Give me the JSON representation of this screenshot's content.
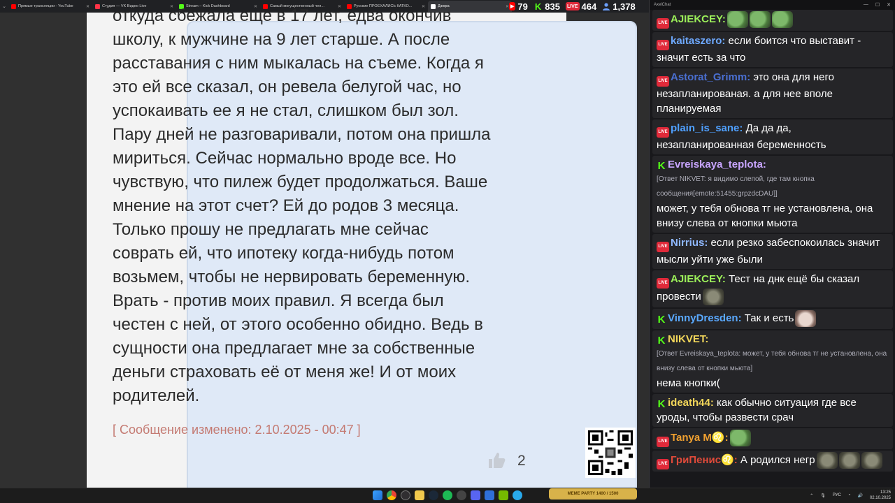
{
  "browser": {
    "tabs": [
      {
        "title": "Прямые трансляции - YouTube",
        "color": "#ff0000",
        "active": false
      },
      {
        "title": "Студия — VK Видео Live",
        "color": "#ff3347",
        "active": false
      },
      {
        "title": "Stream – Kick Dashboard",
        "color": "#53fc18",
        "active": false
      },
      {
        "title": "Самый могущественный чел...",
        "color": "#ff0000",
        "active": false
      },
      {
        "title": "Русские ПРОЕХАЛИСЬ КАТКО...",
        "color": "#ff0000",
        "active": false
      },
      {
        "title": "Дзюра",
        "color": "#ffffff",
        "active": true
      }
    ]
  },
  "counters": [
    {
      "platform": "youtube",
      "icon": "▶",
      "color": "#ff0000",
      "value": "79"
    },
    {
      "platform": "kick",
      "icon": "K",
      "color": "#53fc18",
      "value": "835"
    },
    {
      "platform": "vk-live",
      "icon": "LIVE",
      "color": "#e02a3a",
      "value": "464"
    },
    {
      "platform": "total-viewers",
      "icon": "person-icon",
      "color": "#6ca0ff",
      "value": "1,378"
    }
  ],
  "post": {
    "lines": [
      "откуда сбежала еще в 17 лет, едва окончив",
      "школу, к мужчине на 9 лет старше. А после",
      "расставания с ним мыкалась на съеме. Когда я",
      "это ей все сказал, он ревела белугой час, но",
      "успокаивать ее я не стал, слишком был зол.",
      "Пару дней не разговаривали, потом она пришла",
      "мириться. Сейчас нормально вроде все. Но",
      "чувствую, что пилеж будет продолжаться. Ваше",
      "мнение на этот счет? Ей до родов 3 месяца.",
      "Только прошу не предлагать мне сейчас",
      "соврать ей, что ипотеку когда-нибудь потом",
      "возьмем, чтобы не нервировать беременную.",
      "Врать - против моих правил. Я всегда был",
      "честен с ней, от этого особенно обидно. Ведь в",
      "сущности она предлагает мне за собственные",
      "деньги страховать её от меня же! И от моих",
      "родителей."
    ],
    "edited": "[ Сообщение изменено: 2.10.2025 - 00:47 ]",
    "likes": "2"
  },
  "chat": {
    "window_title": "AxelChat",
    "messages": [
      {
        "platform": "live",
        "user": "AJIEKCEY:",
        "color": "#9cf05a",
        "text": "",
        "emotes": [
          "pepe",
          "pepe",
          "pepe"
        ]
      },
      {
        "platform": "live",
        "user": "kaitaszero:",
        "color": "#6ea9ff",
        "text": "если боится что выставит - значит есть за что"
      },
      {
        "platform": "live",
        "user": "Astorat_Grimm:",
        "color": "#4a6fd1",
        "text": "это она для него незапланированая. а для нее вполе планируемая"
      },
      {
        "platform": "live",
        "user": "plain_is_sane:",
        "color": "#4fa0ff",
        "text": "Да да да, незапланированная беременность"
      },
      {
        "platform": "kick",
        "user": "Evreiskaya_teplota:",
        "color": "#c8a5ff",
        "text": "может, у тебя обнова тг не установлена, она внизу слева от кнопки мьюта",
        "reply": "[Ответ NIKVET: я видимо слепой, где там кнопка сообщения[emote:51455:grpzdcDAU]]"
      },
      {
        "platform": "live",
        "user": "Nirrius:",
        "color": "#8fb8ff",
        "text": "если резко забеспокоилась значит мысли уйти уже были"
      },
      {
        "platform": "live",
        "user": "AJIEKCEY:",
        "color": "#9cf05a",
        "text": "Тест на днк ещё бы сказал провести",
        "emotes": [
          "rat"
        ]
      },
      {
        "platform": "kick",
        "user": "VinnyDresden:",
        "color": "#5aa9ff",
        "text": "Так и есть",
        "emotes": [
          "cat"
        ]
      },
      {
        "platform": "kick",
        "user": "NIKVET:",
        "color": "#f2d65a",
        "text": "нема кнопки(",
        "reply": "[Ответ Evreiskaya_teplota: может, у тебя обнова тг не установлена, она внизу слева от кнопки мьюта]"
      },
      {
        "platform": "kick",
        "user": "ideath44:",
        "color": "#f2d65a",
        "text": "как обычно ситуация где все уроды, чтобы развести срач"
      },
      {
        "platform": "live",
        "user": "Tanya M♌:",
        "color": "#f0a030",
        "text": "",
        "emotes": [
          "pepe"
        ]
      },
      {
        "platform": "live",
        "user": "ГриПенис♌:",
        "color": "#e04a3a",
        "text": "А родился негр",
        "emotes": [
          "rat",
          "rat",
          "rat"
        ]
      }
    ]
  },
  "taskbar": {
    "meme_party": "MEME PARTY  1400 / 1500",
    "lang": "РУС",
    "time": "13:25",
    "date": "02.10.2025"
  }
}
